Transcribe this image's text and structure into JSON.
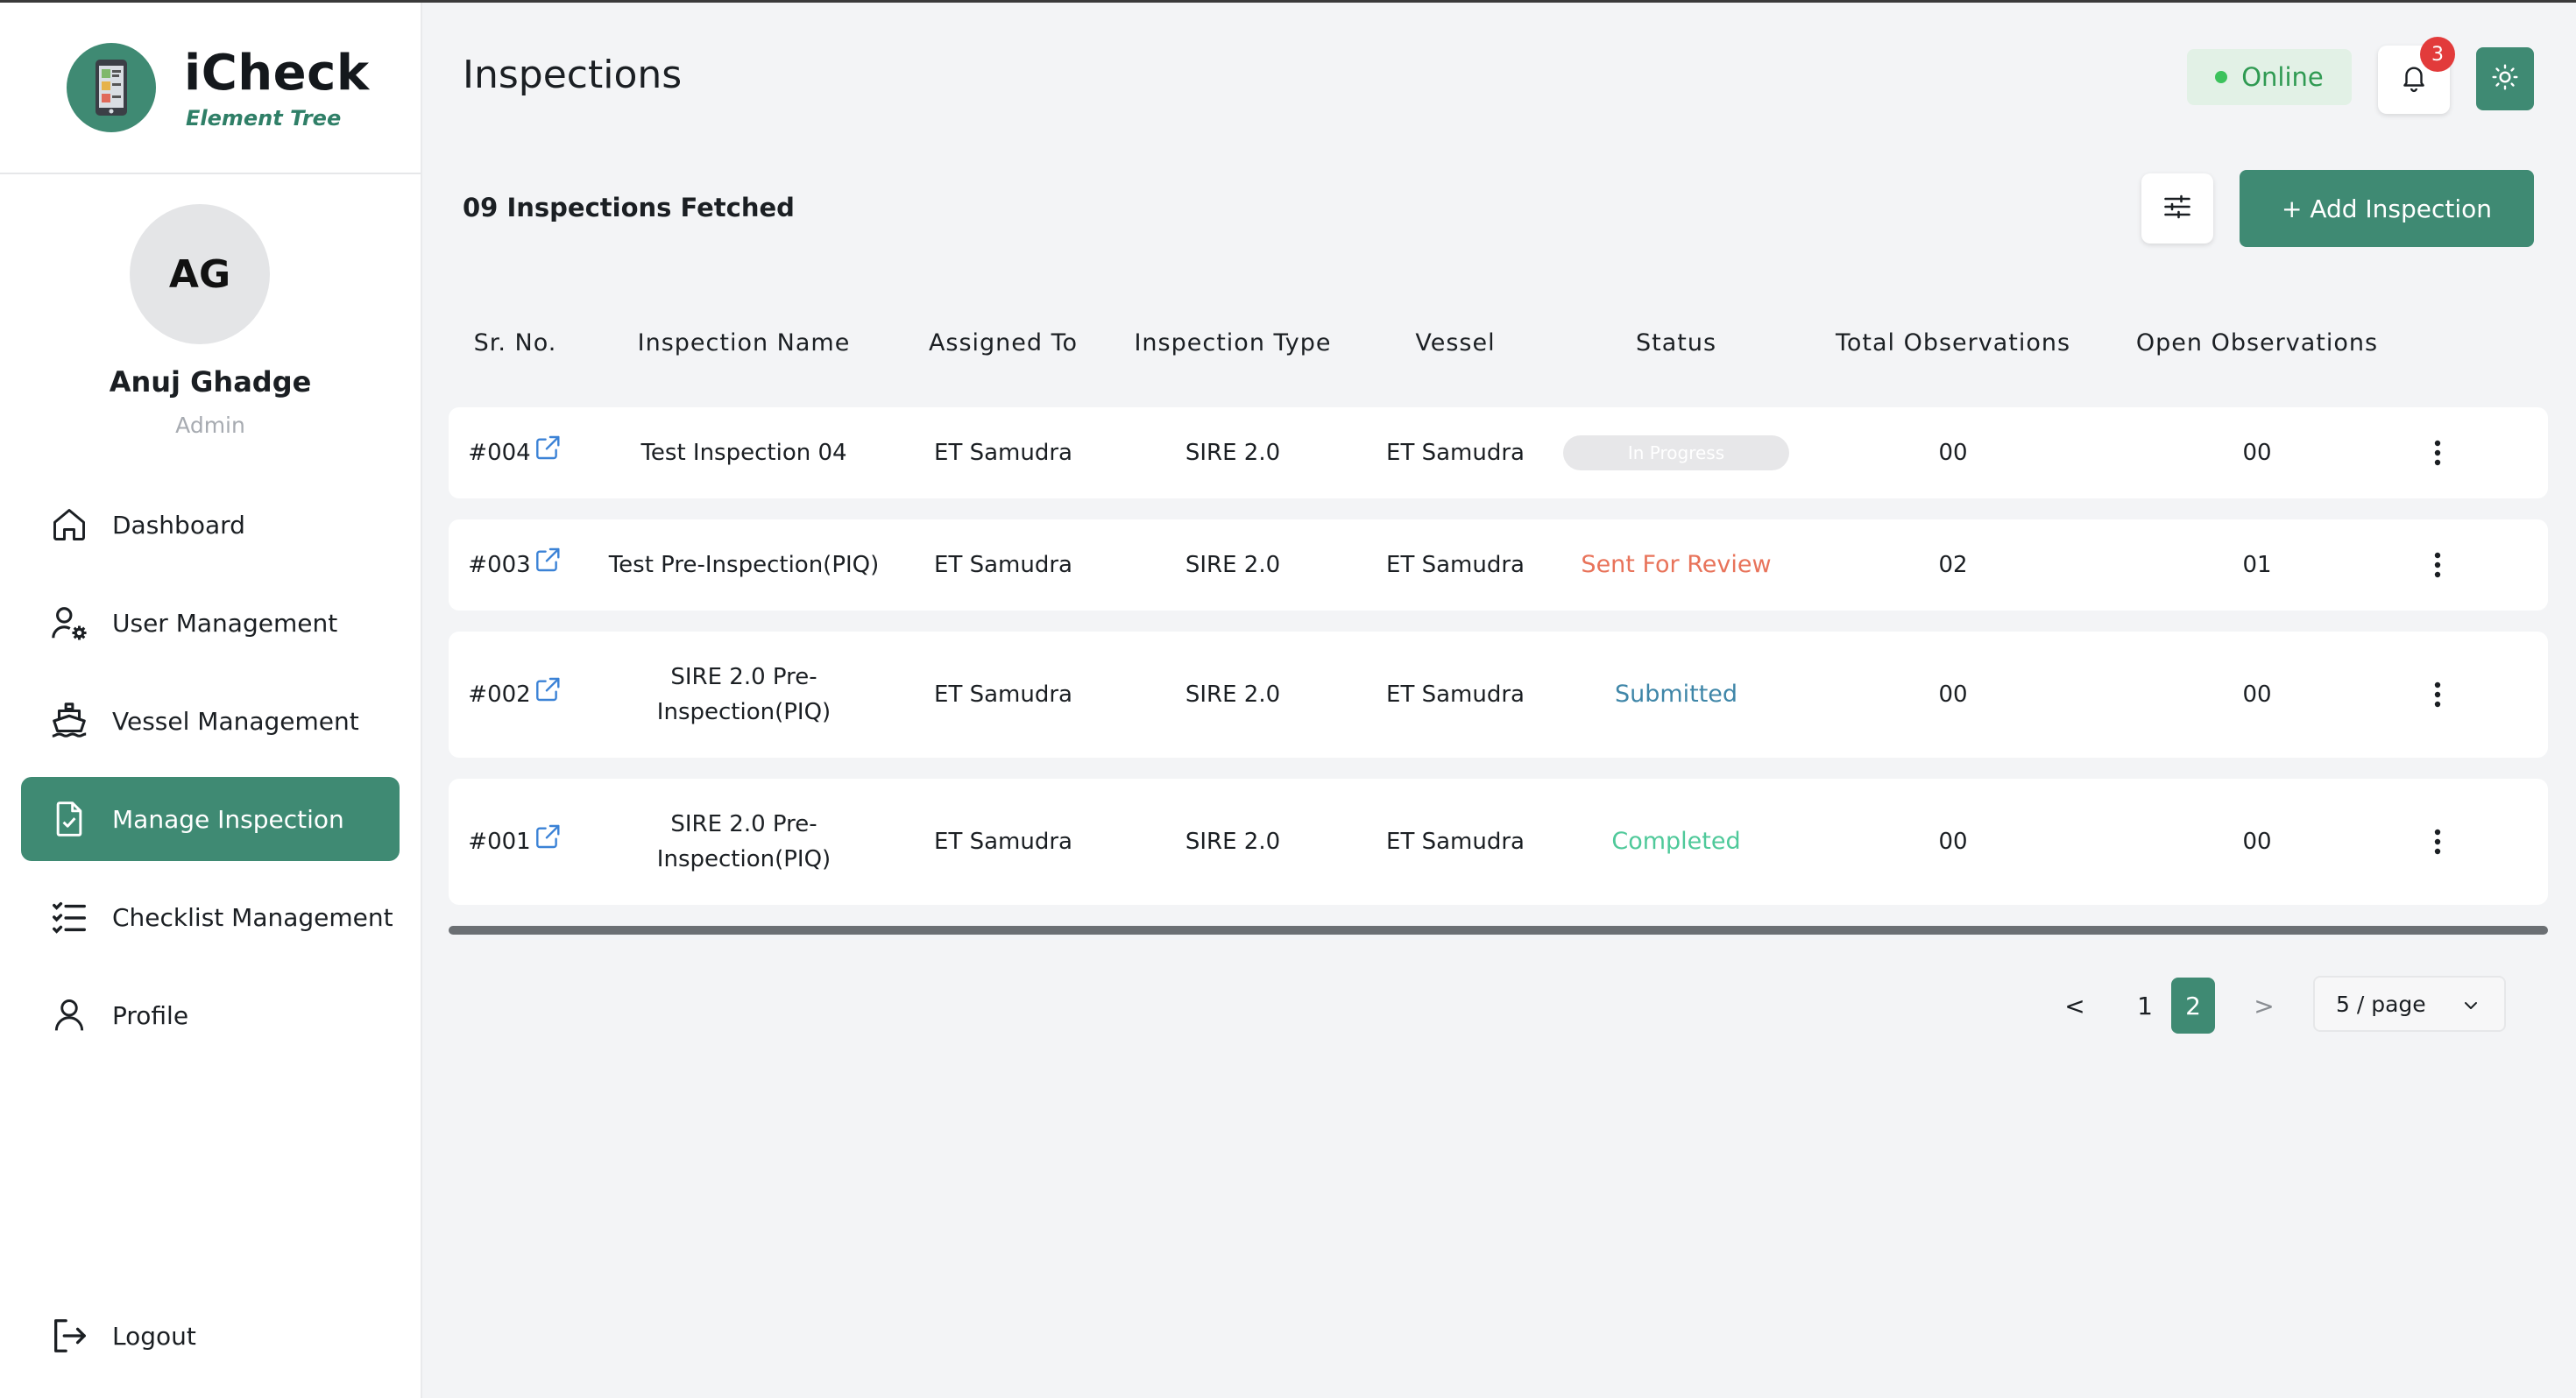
{
  "brand": {
    "name": "iCheck",
    "subtitle": "Element Tree"
  },
  "user": {
    "initials": "AG",
    "name": "Anuj Ghadge",
    "role": "Admin"
  },
  "nav": [
    {
      "label": "Dashboard",
      "icon": "home-icon"
    },
    {
      "label": "User Management",
      "icon": "user-gear-icon"
    },
    {
      "label": "Vessel Management",
      "icon": "ship-icon"
    },
    {
      "label": "Manage Inspection",
      "icon": "document-check-icon",
      "active": true
    },
    {
      "label": "Checklist Management",
      "icon": "checklist-icon"
    },
    {
      "label": "Profile",
      "icon": "person-icon"
    }
  ],
  "logout": {
    "label": "Logout"
  },
  "header": {
    "title": "Inspections",
    "status": "Online",
    "notification_count": "3"
  },
  "toolbar": {
    "fetched_text": "09 Inspections Fetched",
    "add_label": "+ Add Inspection"
  },
  "table": {
    "columns": [
      "Sr. No.",
      "Inspection Name",
      "Assigned To",
      "Inspection Type",
      "Vessel",
      "Status",
      "Total Observations",
      "Open Observations"
    ],
    "rows": [
      {
        "sr": "#004",
        "name_lines": [
          "Test Inspection 04"
        ],
        "assigned": "ET Samudra",
        "type": "SIRE 2.0",
        "vessel": "ET Samudra",
        "status": "In Progress",
        "status_style": "pill",
        "total": "00",
        "open": "00"
      },
      {
        "sr": "#003",
        "name_lines": [
          "Test Pre-Inspection(PIQ)"
        ],
        "assigned": "ET Samudra",
        "type": "SIRE 2.0",
        "vessel": "ET Samudra",
        "status": "Sent For Review",
        "status_style": "review",
        "total": "02",
        "open": "01"
      },
      {
        "sr": "#002",
        "name_lines": [
          "SIRE 2.0 Pre-",
          "Inspection(PIQ)"
        ],
        "assigned": "ET Samudra",
        "type": "SIRE 2.0",
        "vessel": "ET Samudra",
        "status": "Submitted",
        "status_style": "submitted",
        "total": "00",
        "open": "00"
      },
      {
        "sr": "#001",
        "name_lines": [
          "SIRE 2.0 Pre-",
          "Inspection(PIQ)"
        ],
        "assigned": "ET Samudra",
        "type": "SIRE 2.0",
        "vessel": "ET Samudra",
        "status": "Completed",
        "status_style": "completed",
        "total": "00",
        "open": "00"
      }
    ]
  },
  "status_colors": {
    "review": "#e8735a",
    "submitted": "#3f86a8",
    "completed": "#4fc99a"
  },
  "pagination": {
    "prev": "<",
    "next": ">",
    "pages": [
      "1",
      "2"
    ],
    "current": "2",
    "page_size": "5 / page"
  },
  "colors": {
    "accent": "#3f8a73",
    "online": "#3cc25c",
    "badge": "#e23b3b"
  }
}
